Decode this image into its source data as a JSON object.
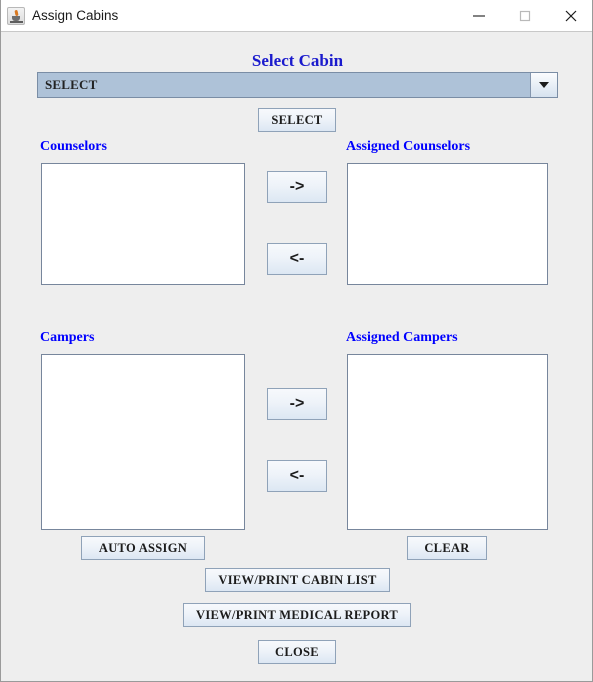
{
  "window": {
    "title": "Assign Cabins",
    "app_icon": "java-coffee-cup-icon",
    "controls": {
      "minimize": "minimize-icon",
      "maximize": "maximize-icon",
      "close": "close-icon"
    },
    "background_color": "#eeeeee"
  },
  "form": {
    "heading": "Select Cabin",
    "accent_label_color": "#0000ff",
    "heading_color": "#1a1acd",
    "cabin_select": {
      "value": "SELECT",
      "options": [
        "SELECT"
      ],
      "arrow_icon": "chevron-down-icon"
    },
    "select_button": "SELECT",
    "counselors": {
      "source_label": "Counselors",
      "assigned_label": "Assigned Counselors",
      "source_items": [],
      "assigned_items": [],
      "move_right": "->",
      "move_left": "<-"
    },
    "campers": {
      "source_label": "Campers",
      "assigned_label": "Assigned Campers",
      "source_items": [],
      "assigned_items": [],
      "move_right": "->",
      "move_left": "<-"
    },
    "actions": {
      "auto_assign": "AUTO ASSIGN",
      "clear": "CLEAR",
      "view_print_cabin_list": "VIEW/PRINT CABIN LIST",
      "view_print_medical_report": "VIEW/PRINT MEDICAL REPORT",
      "close": "CLOSE"
    }
  }
}
